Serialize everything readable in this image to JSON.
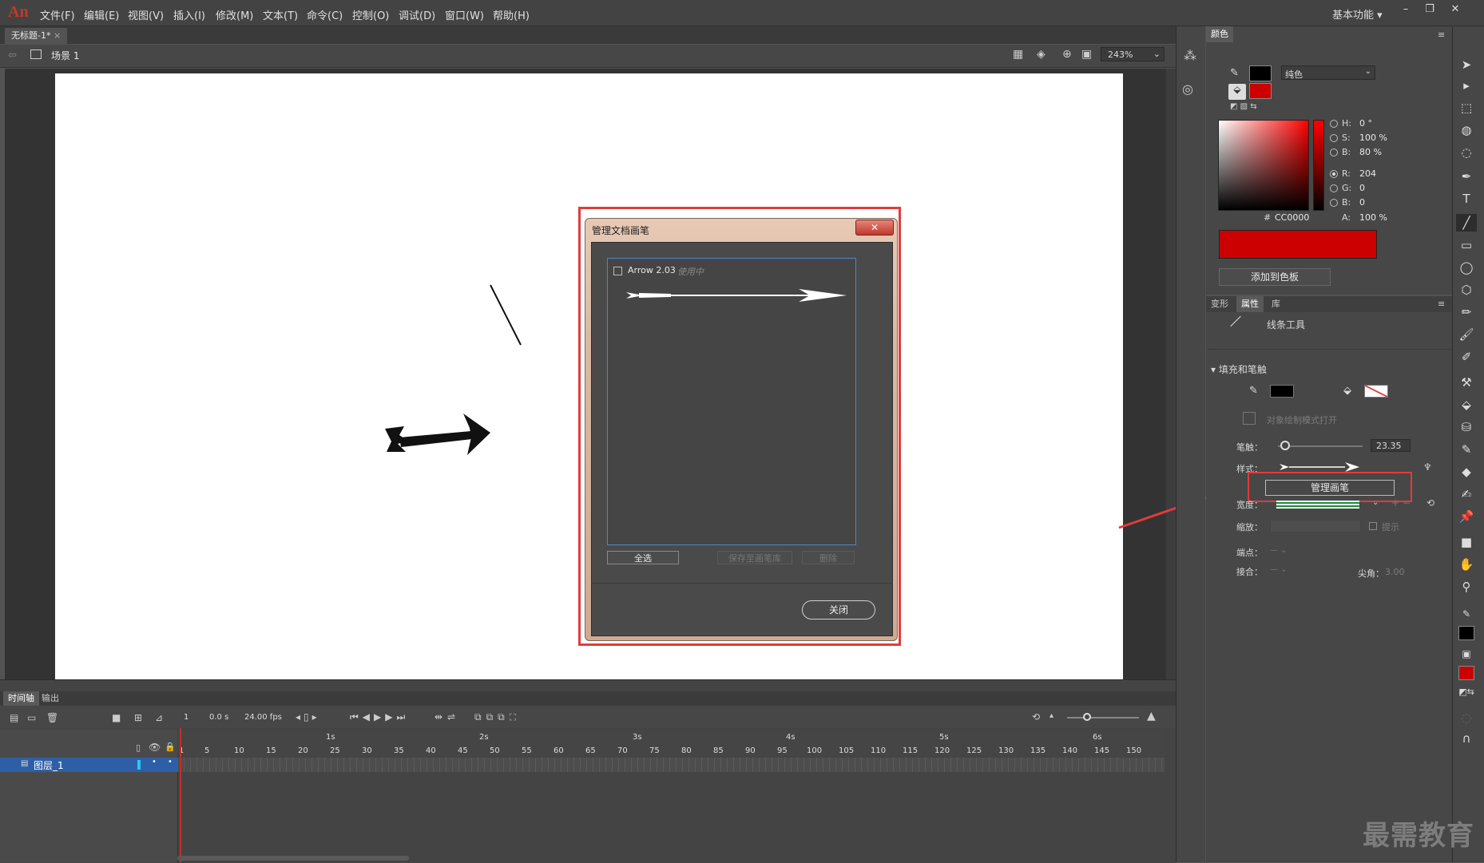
{
  "app": {
    "logo": "An"
  },
  "menu": [
    "文件(F)",
    "编辑(E)",
    "视图(V)",
    "插入(I)",
    "修改(M)",
    "文本(T)",
    "命令(C)",
    "控制(O)",
    "调试(D)",
    "窗口(W)",
    "帮助(H)"
  ],
  "workspace": "基本功能",
  "window_buttons": [
    "–",
    "❐",
    "✕"
  ],
  "document": {
    "tab": "无标题-1*",
    "scene": "场景 1",
    "zoom": "243%"
  },
  "dialog": {
    "title": "管理文档画笔",
    "close_x": "✕",
    "brush_name": "Arrow 2.03",
    "brush_status": "使用中",
    "select_all": "全选",
    "save_to_library": "保存至画笔库",
    "delete": "删除",
    "close": "关闭"
  },
  "color_panel": {
    "tab": "颜色",
    "fill_type": "纯色",
    "H": "0 °",
    "S": "100 %",
    "B": "80 %",
    "R": "204",
    "G": "0",
    "Bv": "0",
    "hex_label": "#",
    "hex": "CC0000",
    "alpha_label": "A:",
    "alpha": "100 %",
    "add_swatch": "添加到色板",
    "stroke_color": "#000000",
    "fill_color": "#cc0000"
  },
  "properties": {
    "tabs": [
      "变形",
      "属性",
      "库"
    ],
    "tool_name": "线条工具",
    "section": "填充和笔触",
    "object_mode": "对象绘制模式打开",
    "stroke_label": "笔触：",
    "stroke_value": "23.35",
    "style_label": "样式：",
    "manage_brush": "管理画笔",
    "width_label": "宽度：",
    "scale_label": "缩放：",
    "hint": "提示",
    "cap_label": "端点：",
    "join_label": "接合：",
    "miter_label": "尖角：",
    "miter_value": "3.00"
  },
  "timeline": {
    "tabs": [
      "时间轴",
      "输出"
    ],
    "frame": "1",
    "time": "0.0 s",
    "fps": "24.00 fps",
    "layer_name": "图层_1",
    "seconds": [
      "1s",
      "2s",
      "3s",
      "4s",
      "5s",
      "6s"
    ],
    "frames": [
      "1",
      "5",
      "10",
      "15",
      "20",
      "25",
      "30",
      "35",
      "40",
      "45",
      "50",
      "55",
      "60",
      "65",
      "70",
      "75",
      "80",
      "85",
      "90",
      "95",
      "100",
      "105",
      "110",
      "115",
      "120",
      "125",
      "130",
      "135",
      "140",
      "145",
      "150"
    ]
  },
  "watermark": "最需教育"
}
